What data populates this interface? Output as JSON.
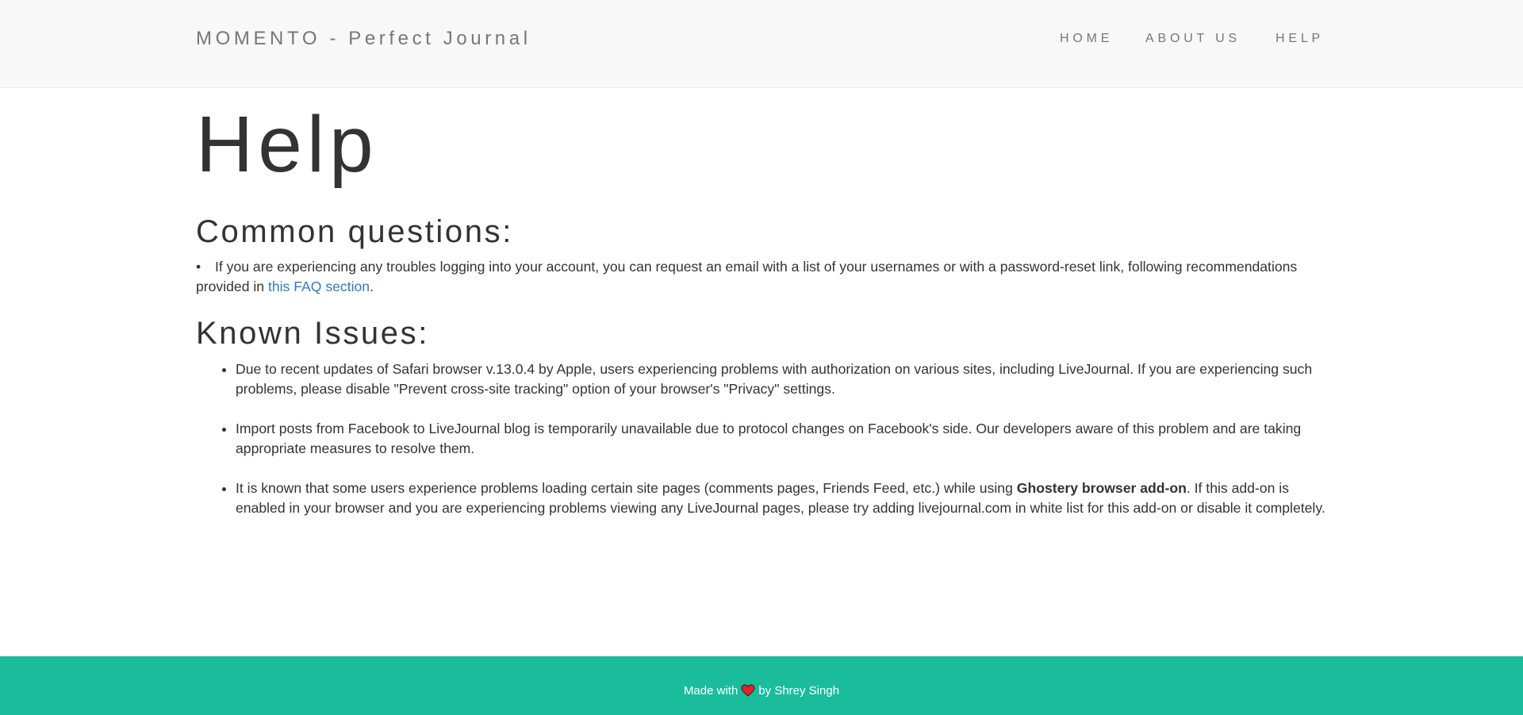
{
  "header": {
    "brand": "MOMENTO - Perfect Journal",
    "nav": [
      {
        "label": "HOME"
      },
      {
        "label": "ABOUT US"
      },
      {
        "label": "HELP"
      }
    ]
  },
  "main": {
    "title": "Help",
    "common_questions": {
      "heading": "Common questions:",
      "bullet": "•",
      "item_text": "If you are experiencing any troubles logging into your account, you can request an email with a list of your usernames or with a password-reset link, following recommendations provided in",
      "link_text": "this FAQ section",
      "item_end": "."
    },
    "known_issues": {
      "heading": "Known Issues:",
      "items": [
        {
          "text": "Due to recent updates of Safari browser v.13.0.4 by Apple, users experiencing problems with authorization on various sites, including LiveJournal. If you are experiencing such problems, please disable \"Prevent cross-site tracking\" option of your browser's \"Privacy\" settings."
        },
        {
          "text": "Import posts from Facebook to LiveJournal blog is temporarily unavailable due to protocol changes on Facebook's side. Our developers aware of this problem and are taking appropriate measures to resolve them."
        },
        {
          "text_before": "It is known that some users experience problems loading certain site pages (comments pages, Friends Feed, etc.) while using",
          "bold": "Ghostery browser add-on",
          "text_after": ". If this add-on is enabled in your browser and you are experiencing problems viewing any LiveJournal pages, please try adding livejournal.com in white list for this add-on or disable it completely."
        }
      ]
    }
  },
  "footer": {
    "made_with": "Made with",
    "icon": "heart-icon",
    "by": "by Shrey Singh"
  },
  "colors": {
    "navbar_bg": "#f8f8f8",
    "footer_bg": "#1abc9c",
    "link": "#337ab7",
    "heart": "#e8202a"
  }
}
